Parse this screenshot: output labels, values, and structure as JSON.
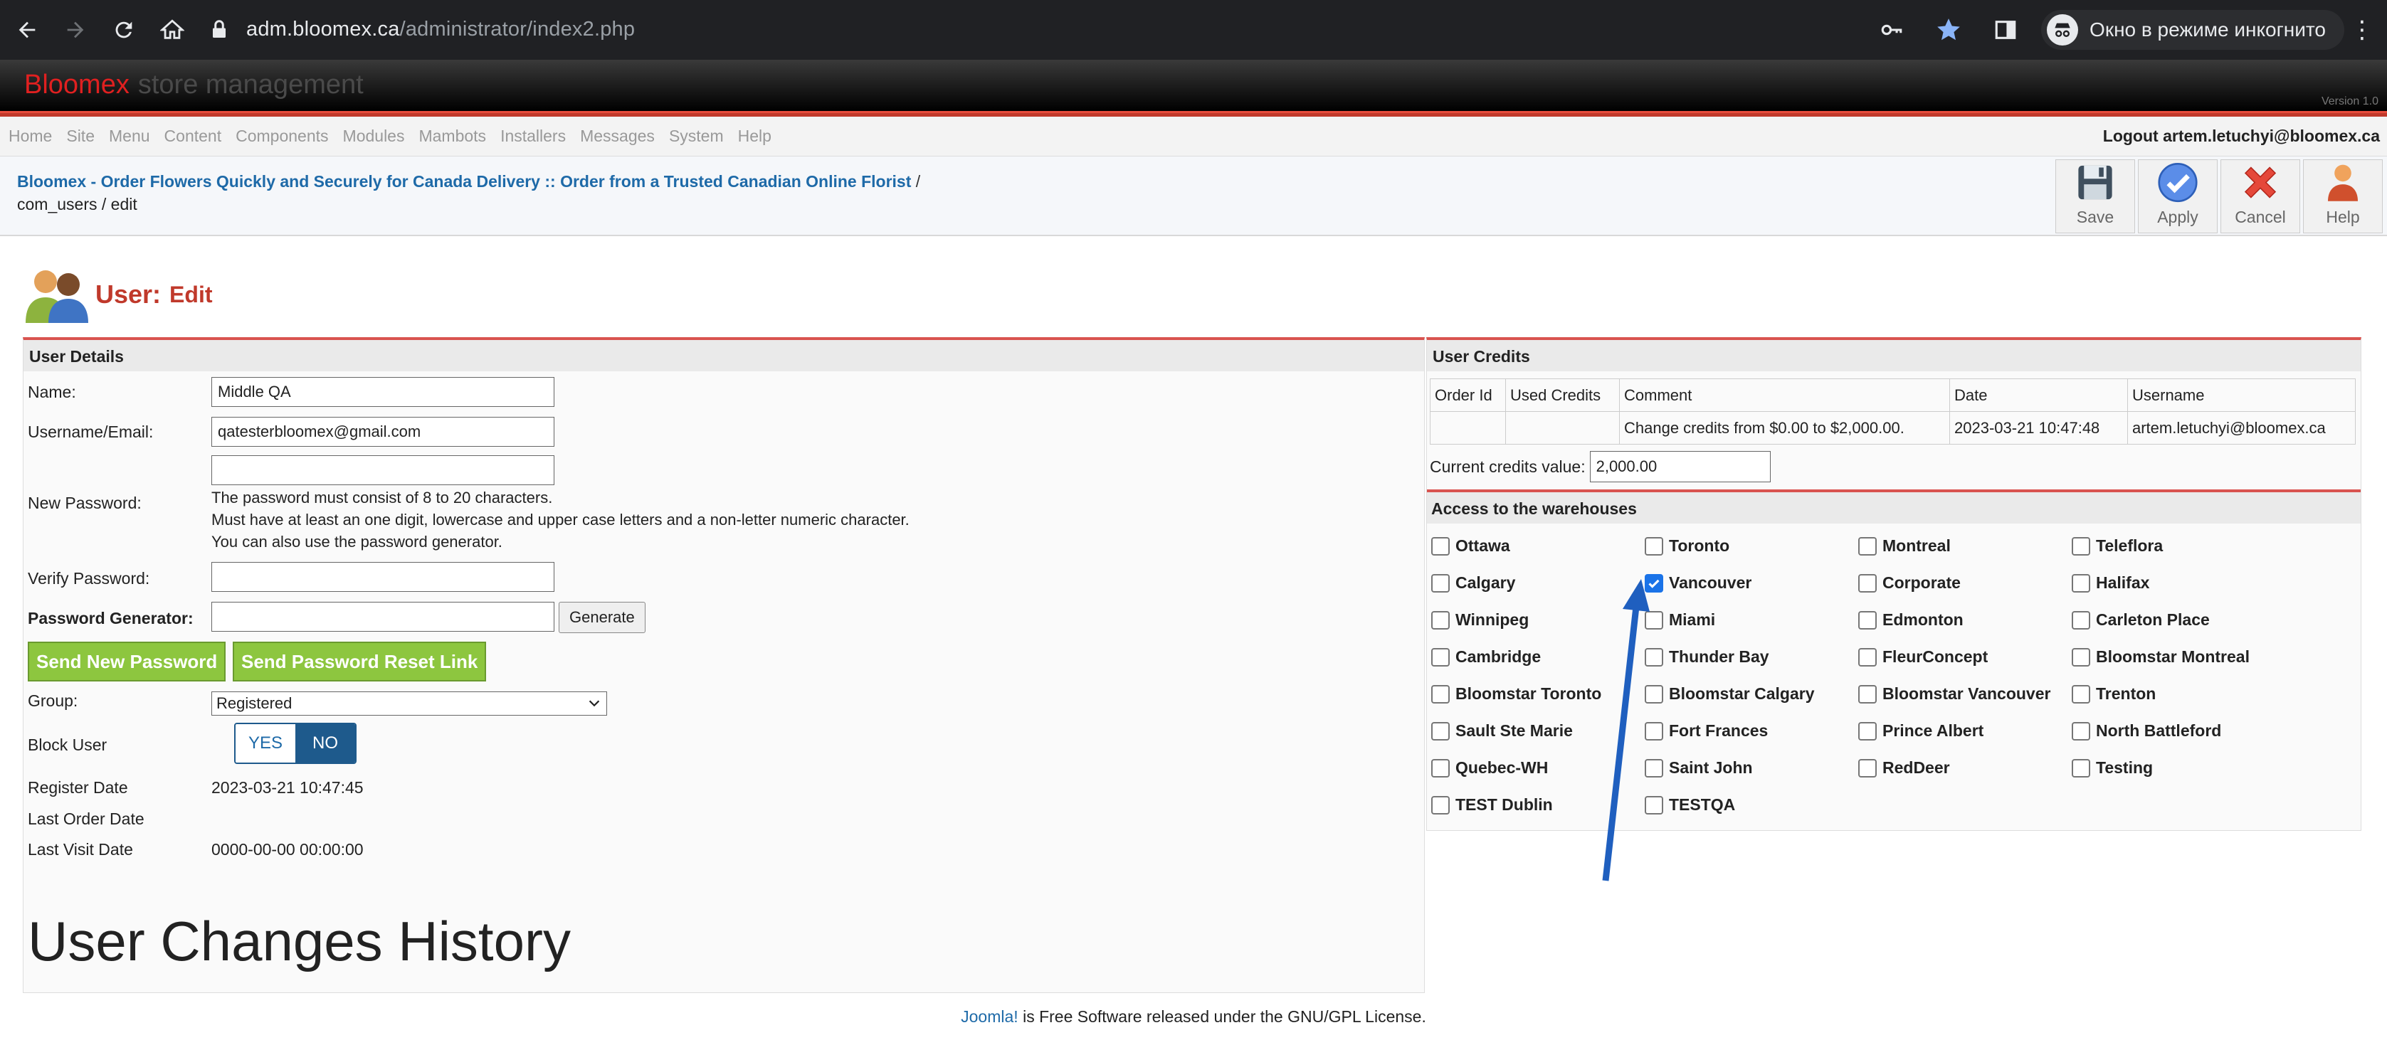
{
  "browser": {
    "url_host": "adm.bloomex.ca",
    "url_path": "/administrator/index2.php",
    "incognito_label": "Окно в режиме инкогнито"
  },
  "header": {
    "brand_red": "Bloomex",
    "brand_gray": "store management",
    "version": "Version 1.0"
  },
  "menu": {
    "items": [
      "Home",
      "Site",
      "Menu",
      "Content",
      "Components",
      "Modules",
      "Mambots",
      "Installers",
      "Messages",
      "System",
      "Help"
    ],
    "logout": "Logout artem.letuchyi@bloomex.ca"
  },
  "breadcrumb": {
    "site_title": "Bloomex - Order Flowers Quickly and Securely for Canada Delivery :: Order from a Trusted Canadian Online Florist",
    "separator": "/",
    "sub": "com_users / edit"
  },
  "toolbar": {
    "save": "Save",
    "apply": "Apply",
    "cancel": "Cancel",
    "help": "Help"
  },
  "page": {
    "title_main": "User:",
    "title_sub": "Edit"
  },
  "user_details": {
    "heading": "User Details",
    "name_label": "Name:",
    "name_value": "Middle QA",
    "username_label": "Username/Email:",
    "username_value": "qatesterbloomex@gmail.com",
    "new_password_label": "New Password:",
    "password_hint_1": "The password must consist of 8 to 20 characters.",
    "password_hint_2": "Must have at least an one digit, lowercase and upper case letters and a non-letter numeric character.",
    "password_hint_3": "You can also use the password generator.",
    "verify_password_label": "Verify Password:",
    "password_generator_label": "Password Generator:",
    "generate_button": "Generate",
    "send_new_password": "Send New Password",
    "send_reset_link": "Send Password Reset Link",
    "group_label": "Group:",
    "group_value": "Registered",
    "block_user_label": "Block User",
    "block_yes": "YES",
    "block_no": "NO",
    "register_date_label": "Register Date",
    "register_date_value": "2023-03-21 10:47:45",
    "last_order_date_label": "Last Order Date",
    "last_visit_date_label": "Last Visit Date",
    "last_visit_date_value": "0000-00-00 00:00:00",
    "history_title": "User Changes History"
  },
  "user_credits": {
    "heading": "User Credits",
    "columns": [
      "Order Id",
      "Used Credits",
      "Comment",
      "Date",
      "Username"
    ],
    "rows": [
      [
        "",
        "",
        "Change credits from $0.00 to $2,000.00.",
        "2023-03-21 10:47:48",
        "artem.letuchyi@bloomex.ca"
      ]
    ],
    "current_label": "Current credits value:",
    "current_value": "2,000.00"
  },
  "warehouses": {
    "heading": "Access to the warehouses",
    "items": [
      {
        "name": "Ottawa",
        "checked": false
      },
      {
        "name": "Toronto",
        "checked": false
      },
      {
        "name": "Montreal",
        "checked": false
      },
      {
        "name": "Teleflora",
        "checked": false
      },
      {
        "name": "Calgary",
        "checked": false
      },
      {
        "name": "Vancouver",
        "checked": true
      },
      {
        "name": "Corporate",
        "checked": false
      },
      {
        "name": "Halifax",
        "checked": false
      },
      {
        "name": "Winnipeg",
        "checked": false
      },
      {
        "name": "Miami",
        "checked": false
      },
      {
        "name": "Edmonton",
        "checked": false
      },
      {
        "name": "Carleton Place",
        "checked": false
      },
      {
        "name": "Cambridge",
        "checked": false
      },
      {
        "name": "Thunder Bay",
        "checked": false
      },
      {
        "name": "FleurConcept",
        "checked": false
      },
      {
        "name": "Bloomstar Montreal",
        "checked": false
      },
      {
        "name": "Bloomstar Toronto",
        "checked": false
      },
      {
        "name": "Bloomstar Calgary",
        "checked": false
      },
      {
        "name": "Bloomstar Vancouver",
        "checked": false
      },
      {
        "name": "Trenton",
        "checked": false
      },
      {
        "name": "Sault Ste Marie",
        "checked": false
      },
      {
        "name": "Fort Frances",
        "checked": false
      },
      {
        "name": "Prince Albert",
        "checked": false
      },
      {
        "name": "North Battleford",
        "checked": false
      },
      {
        "name": "Quebec-WH",
        "checked": false
      },
      {
        "name": "Saint John",
        "checked": false
      },
      {
        "name": "RedDeer",
        "checked": false
      },
      {
        "name": "Testing",
        "checked": false
      },
      {
        "name": "TEST Dublin",
        "checked": false
      },
      {
        "name": "TESTQA",
        "checked": false
      }
    ]
  },
  "footer": {
    "link": "Joomla!",
    "text": " is Free Software released under the GNU/GPL License."
  },
  "colors": {
    "accent_red": "#c0392b",
    "link_blue": "#1e6aa8",
    "green_button": "#8dc63f",
    "annotation_arrow": "#1f5fbf"
  }
}
